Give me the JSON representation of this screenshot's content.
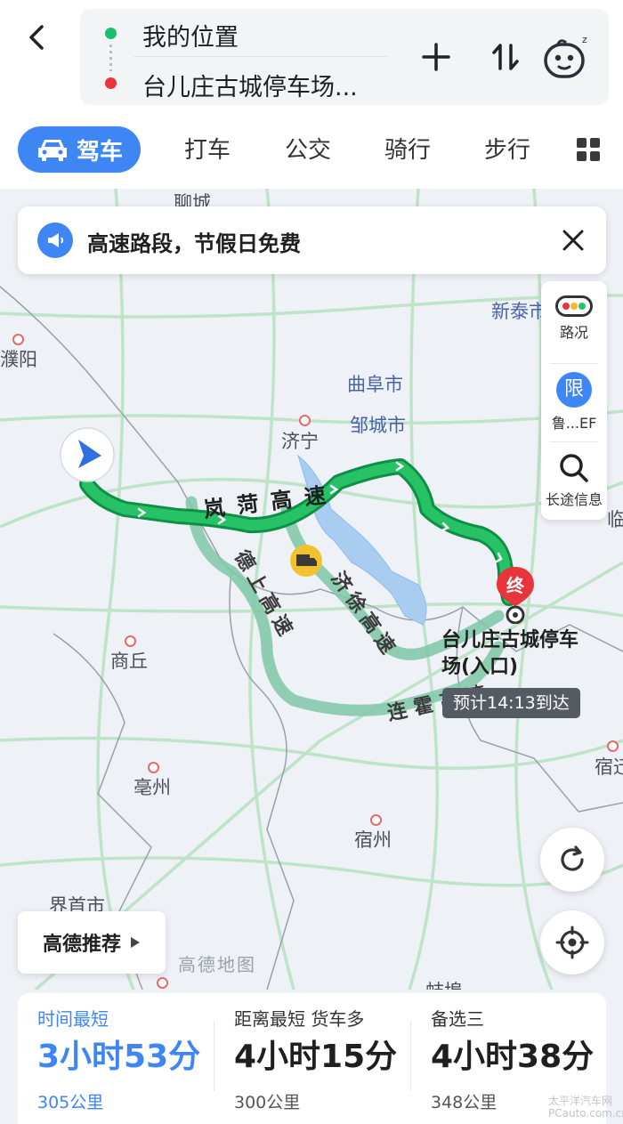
{
  "header": {
    "start": "我的位置",
    "end": "台儿庄古城停车场...",
    "icons": {
      "back": "back-arrow-icon",
      "add": "plus-icon",
      "swap": "swap-icon",
      "assistant": "robot-assistant-icon"
    }
  },
  "modes": {
    "active": "驾车",
    "tabs": [
      "打车",
      "公交",
      "骑行",
      "步行"
    ]
  },
  "notice": {
    "text": "高速路段，节假日免费"
  },
  "side_tools": {
    "traffic": "路况",
    "restriction_badge": "限",
    "restriction": "鲁...EF",
    "long_distance": "长途信息"
  },
  "map": {
    "cities": {
      "liaocheng": "聊城",
      "xintai": "新泰市",
      "puyang": "濮阳",
      "qufu": "曲阜市",
      "zoucheng": "邹城市",
      "jining": "济宁",
      "linyi": "临",
      "shangqiu": "商丘",
      "bozhou": "亳州",
      "suzhou": "宿州",
      "suqian": "宿迁",
      "jieshou": "界首市",
      "bengbu": "蚌埠"
    },
    "routes": {
      "main": "岚菏高速",
      "alt1": "德上高速",
      "alt2": "济徐高速",
      "alt3": "连霍高速"
    },
    "destination": "台儿庄古城停车场(入口)",
    "end_badge": "终",
    "eta": "预计14:13到达",
    "recommend": "高德推荐",
    "watermark": "高德地图"
  },
  "route_options": [
    {
      "title": "时间最短",
      "time": "3小时53分",
      "distance": "305公里"
    },
    {
      "title": "距离最短  货车多",
      "time": "4小时15分",
      "distance": "300公里"
    },
    {
      "title": "备选三",
      "time": "4小时38分",
      "distance": "348公里"
    }
  ],
  "colors": {
    "primary": "#3d86f4",
    "route_main": "#1fb35a",
    "route_alt": "#7fc7a8",
    "end_marker": "#e8343a"
  },
  "corner_watermark": [
    "太平洋汽车网",
    "PCauto.com.cn"
  ]
}
